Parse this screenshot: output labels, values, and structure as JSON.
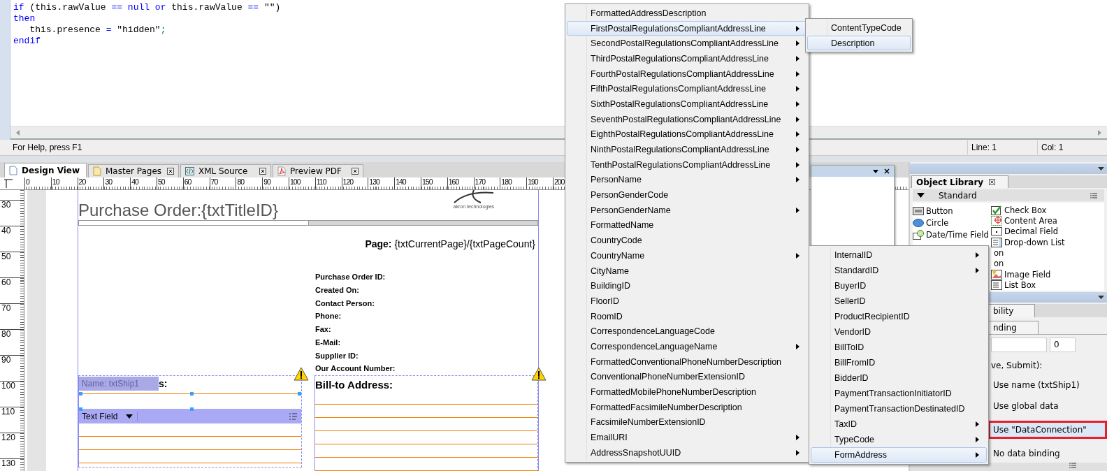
{
  "editor": {
    "code": [
      [
        {
          "text": "if",
          "kind": "keyword"
        },
        {
          "text": " (this.rawValue ",
          "kind": "plain"
        },
        {
          "text": "==",
          "kind": "operator"
        },
        {
          "text": " null",
          "kind": "keyword"
        },
        {
          "text": " or",
          "kind": "keyword"
        },
        {
          "text": " this.rawValue ",
          "kind": "plain"
        },
        {
          "text": "==",
          "kind": "operator"
        },
        {
          "text": " \"\")",
          "kind": "plain"
        }
      ],
      [
        {
          "text": "then",
          "kind": "keyword"
        }
      ],
      [
        {
          "text": "   this.presence ",
          "kind": "plain"
        },
        {
          "text": "=",
          "kind": "operator"
        },
        {
          "text": " \"hidden\"",
          "kind": "plain"
        },
        {
          "text": ";",
          "kind": "punct"
        }
      ],
      [
        {
          "text": "endif",
          "kind": "keyword"
        }
      ]
    ]
  },
  "status_bar": {
    "help": "For Help, press F1",
    "line": "Line: 1",
    "col": "Col: 1"
  },
  "tabs": [
    {
      "label": "Design View",
      "selected": true,
      "closable": false,
      "kind": "page"
    },
    {
      "label": "Master Pages",
      "selected": false,
      "closable": true,
      "kind": "pages"
    },
    {
      "label": "XML Source",
      "selected": false,
      "closable": true,
      "kind": "xml"
    },
    {
      "label": "Preview PDF",
      "selected": false,
      "closable": true,
      "kind": "pdf"
    }
  ],
  "ruler": {
    "horizontal": [
      "0",
      "10",
      "20",
      "30",
      "40",
      "50",
      "60",
      "70",
      "80",
      "90",
      "100",
      "110",
      "120",
      "130",
      "140",
      "150",
      "160",
      "170",
      "180",
      "190",
      "200"
    ],
    "vertical": [
      "30",
      "40",
      "50",
      "60",
      "70",
      "80",
      "90",
      "100",
      "110",
      "120",
      "130"
    ]
  },
  "form": {
    "title": "Purchase Order:{txtTitleID}",
    "logo_text": "akron technologies",
    "page_counter": "**Page:** {txtCurrentPage}/{txtPageCount}",
    "header_fields": [
      "Purchase Order ID:",
      "Created On:",
      "Contact Person:",
      "Phone:",
      "Fax:",
      "E-Mail:",
      "Supplier ID:",
      "Our Account Number:"
    ],
    "ship_section": {
      "heading": "s:",
      "tooltip": "Name: txtShip1",
      "field_type": "Text Field"
    },
    "bill_section": {
      "heading": "Bill-to Address:"
    }
  },
  "object_library": {
    "title": "Object Library",
    "group": "Standard",
    "column_1": [
      {
        "label": "Button",
        "kind": "ok"
      },
      {
        "label": "Circle",
        "kind": "circle"
      },
      {
        "label": "Date/Time Field",
        "kind": "datetime"
      }
    ],
    "column_2": [
      {
        "label": "Check Box",
        "kind": "check"
      },
      {
        "label": "Content Area",
        "kind": "content"
      },
      {
        "label": "Decimal Field",
        "kind": "decimal"
      },
      {
        "label": "Drop-down List",
        "kind": "dropdown"
      },
      {
        "label": "on",
        "kind": "fragment"
      },
      {
        "label": "on",
        "kind": "fragment"
      },
      {
        "label": "Image Field",
        "kind": "image"
      },
      {
        "label": "List Box",
        "kind": "list"
      }
    ]
  },
  "properties": {
    "tab": "bility",
    "subtab": "nding",
    "field_value": "0",
    "label": "ve, Submit):",
    "options": [
      {
        "label": "Use name (txtShip1)",
        "selected": false
      },
      {
        "label": "Use global data",
        "selected": false
      },
      {
        "label": "Use \"DataConnection\"",
        "selected": true
      },
      {
        "label": "No data binding",
        "selected": false
      }
    ]
  },
  "context_menu": {
    "items": [
      {
        "label": "FormattedAddressDescription",
        "submenu": false,
        "selected": false
      },
      {
        "label": "FirstPostalRegulationsCompliantAddressLine",
        "submenu": true,
        "selected": true
      },
      {
        "label": "SecondPostalRegulationsCompliantAddressLine",
        "submenu": true,
        "selected": false
      },
      {
        "label": "ThirdPostalRegulationsCompliantAddressLine",
        "submenu": true,
        "selected": false
      },
      {
        "label": "FourthPostalRegulationsCompliantAddressLine",
        "submenu": true,
        "selected": false
      },
      {
        "label": "FifthPostalRegulationsCompliantAddressLine",
        "submenu": true,
        "selected": false
      },
      {
        "label": "SixthPostalRegulationsCompliantAddressLine",
        "submenu": true,
        "selected": false
      },
      {
        "label": "SeventhPostalRegulationsCompliantAddressLine",
        "submenu": true,
        "selected": false
      },
      {
        "label": "EighthPostalRegulationsCompliantAddressLine",
        "submenu": true,
        "selected": false
      },
      {
        "label": "NinthPostalRegulationsCompliantAddressLine",
        "submenu": true,
        "selected": false
      },
      {
        "label": "TenthPostalRegulationsCompliantAddressLine",
        "submenu": true,
        "selected": false
      },
      {
        "label": "PersonName",
        "submenu": true,
        "selected": false
      },
      {
        "label": "PersonGenderCode",
        "submenu": false,
        "selected": false
      },
      {
        "label": "PersonGenderName",
        "submenu": true,
        "selected": false
      },
      {
        "label": "FormattedName",
        "submenu": false,
        "selected": false
      },
      {
        "label": "CountryCode",
        "submenu": false,
        "selected": false
      },
      {
        "label": "CountryName",
        "submenu": true,
        "selected": false
      },
      {
        "label": "CityName",
        "submenu": false,
        "selected": false
      },
      {
        "label": "BuildingID",
        "submenu": false,
        "selected": false
      },
      {
        "label": "FloorID",
        "submenu": false,
        "selected": false
      },
      {
        "label": "RoomID",
        "submenu": false,
        "selected": false
      },
      {
        "label": "CorrespondenceLanguageCode",
        "submenu": false,
        "selected": false
      },
      {
        "label": "CorrespondenceLanguageName",
        "submenu": true,
        "selected": false
      },
      {
        "label": "FormattedConventionalPhoneNumberDescription",
        "submenu": false,
        "selected": false
      },
      {
        "label": "ConventionalPhoneNumberExtensionID",
        "submenu": false,
        "selected": false
      },
      {
        "label": "FormattedMobilePhoneNumberDescription",
        "submenu": false,
        "selected": false
      },
      {
        "label": "FormattedFacsimileNumberDescription",
        "submenu": false,
        "selected": false
      },
      {
        "label": "FacsimileNumberExtensionID",
        "submenu": false,
        "selected": false
      },
      {
        "label": "EmailURI",
        "submenu": true,
        "selected": false
      },
      {
        "label": "AddressSnapshotUUID",
        "submenu": true,
        "selected": false
      }
    ]
  },
  "submenu_1": {
    "items": [
      {
        "label": "ContentTypeCode",
        "submenu": false,
        "selected": false
      },
      {
        "label": "Description",
        "submenu": false,
        "selected": true
      }
    ]
  },
  "submenu_2": {
    "items": [
      {
        "label": "InternalID",
        "submenu": true,
        "selected": false
      },
      {
        "label": "StandardID",
        "submenu": true,
        "selected": false
      },
      {
        "label": "BuyerID",
        "submenu": false,
        "selected": false
      },
      {
        "label": "SellerID",
        "submenu": false,
        "selected": false
      },
      {
        "label": "ProductRecipientID",
        "submenu": false,
        "selected": false
      },
      {
        "label": "VendorID",
        "submenu": false,
        "selected": false
      },
      {
        "label": "BillToID",
        "submenu": false,
        "selected": false
      },
      {
        "label": "BillFromID",
        "submenu": false,
        "selected": false
      },
      {
        "label": "BidderID",
        "submenu": false,
        "selected": false
      },
      {
        "label": "PaymentTransactionInitiatorID",
        "submenu": false,
        "selected": false
      },
      {
        "label": "PaymentTransactionDestinatedID",
        "submenu": false,
        "selected": false
      },
      {
        "label": "TaxID",
        "submenu": true,
        "selected": false
      },
      {
        "label": "TypeCode",
        "submenu": true,
        "selected": false
      },
      {
        "label": "FormAddress",
        "submenu": true,
        "selected": true
      }
    ]
  }
}
